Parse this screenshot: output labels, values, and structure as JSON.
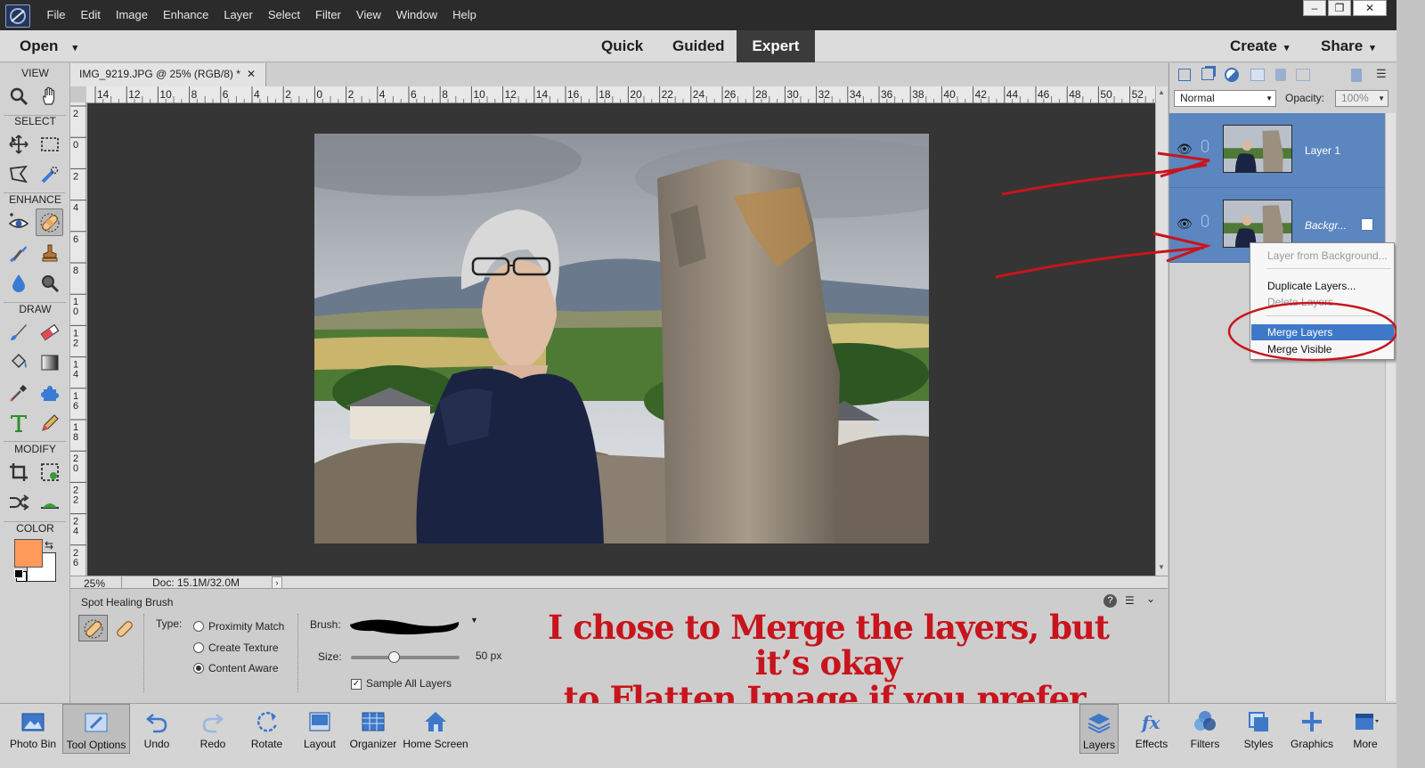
{
  "menubar": {
    "items": [
      "File",
      "Edit",
      "Image",
      "Enhance",
      "Layer",
      "Select",
      "Filter",
      "View",
      "Window",
      "Help"
    ],
    "window_buttons": [
      "–",
      "❐",
      "✕"
    ]
  },
  "modes": {
    "open": "Open",
    "quick": "Quick",
    "guided": "Guided",
    "expert": "Expert",
    "create": "Create",
    "share": "Share"
  },
  "toolbox": {
    "view": "VIEW",
    "select": "SELECT",
    "enhance": "ENHANCE",
    "draw": "DRAW",
    "modify": "MODIFY",
    "color": "COLOR",
    "foreground_color": "#ff9a5a",
    "background_color": "#ffffff"
  },
  "document": {
    "tab_title": "IMG_9219.JPG @ 25% (RGB/8) *",
    "zoom": "25%",
    "doc_info": "Doc: 15.1M/32.0M"
  },
  "ruler": {
    "h_labels": [
      "14",
      "12",
      "10",
      "8",
      "6",
      "4",
      "2",
      "0",
      "2",
      "4",
      "6",
      "8",
      "10",
      "12",
      "14",
      "16",
      "18",
      "20",
      "22",
      "24",
      "26",
      "28",
      "30",
      "32",
      "34",
      "36",
      "38",
      "40",
      "42",
      "44",
      "46",
      "48",
      "50",
      "52"
    ],
    "v_labels": [
      "2",
      "0",
      "2",
      "4",
      "6",
      "8",
      "1\n0",
      "1\n2",
      "1\n4",
      "1\n6",
      "1\n8",
      "2\n0",
      "2\n2",
      "2\n4",
      "2\n6"
    ]
  },
  "options": {
    "tool_name": "Spot Healing Brush",
    "type_label": "Type:",
    "types": [
      "Proximity Match",
      "Create Texture",
      "Content Aware"
    ],
    "selected_type": 2,
    "brush_label": "Brush:",
    "size_label": "Size:",
    "size_value": "50 px",
    "sample_all": "Sample All Layers",
    "size_fraction": 0.39
  },
  "annotation": {
    "line1": "I chose to Merge the layers, but it’s okay",
    "line2": "to Flatten Image if you prefer.",
    "color": "#c8141c"
  },
  "layers_panel": {
    "blend_mode": "Normal",
    "opacity_label": "Opacity:",
    "opacity_value": "100%",
    "layers": [
      {
        "name": "Layer 1"
      },
      {
        "name": "Backgr..."
      }
    ]
  },
  "context_menu": {
    "items": [
      {
        "label": "Layer from Background...",
        "enabled": false
      },
      {
        "label": "Duplicate Layers...",
        "enabled": true
      },
      {
        "label": "Delete Layers",
        "enabled": false
      },
      {
        "label": "Merge Layers",
        "enabled": true,
        "highlighted": true
      },
      {
        "label": "Merge Visible",
        "enabled": true
      }
    ]
  },
  "taskbar": {
    "left": [
      "Photo Bin",
      "Tool Options",
      "Undo",
      "Redo",
      "Rotate",
      "Layout",
      "Organizer",
      "Home Screen"
    ],
    "right": [
      "Layers",
      "Effects",
      "Filters",
      "Styles",
      "Graphics",
      "More"
    ]
  },
  "colors": {
    "accent": "#5b86c0",
    "menubar_bg": "#2b2b2b",
    "highlight": "#3d78c9"
  }
}
